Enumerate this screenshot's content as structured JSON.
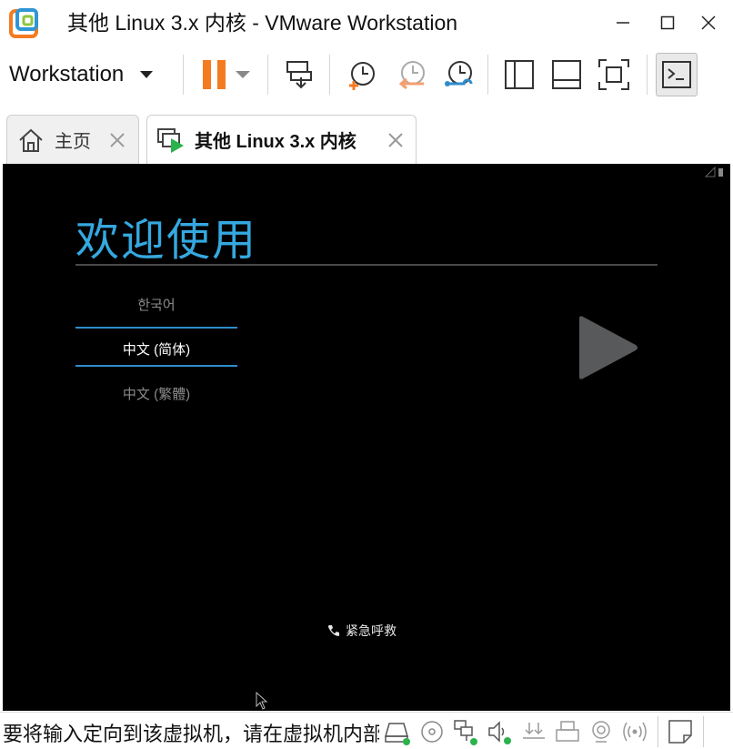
{
  "window": {
    "title": "其他 Linux 3.x 内核 - VMware Workstation",
    "controls": [
      "minimize",
      "maximize",
      "close"
    ]
  },
  "toolbar": {
    "menu_label": "Workstation",
    "buttons": [
      "pause-icon",
      "send-keys-icon",
      "snapshot-take-icon",
      "snapshot-revert-icon",
      "snapshot-manager-icon",
      "library-icon",
      "thumbnail-icon",
      "fullscreen-icon",
      "console-view-icon"
    ]
  },
  "tabs": [
    {
      "label": "主页",
      "icon": "home-icon"
    },
    {
      "label": "其他 Linux 3.x 内核",
      "icon": "vm-running-icon",
      "active": true
    }
  ],
  "vm": {
    "heading": "欢迎使用",
    "languages": [
      {
        "label": "한국어"
      },
      {
        "label": "中文 (简体)",
        "selected": true
      },
      {
        "label": "中文 (繁體)"
      }
    ],
    "emergency_label": "紧急呼救"
  },
  "statusbar": {
    "message": "要将输入定向到该虚拟机，请在虚拟机内部单击或按 Ctrl+G。",
    "devices": [
      "hard-disk-icon",
      "cd-dvd-icon",
      "network-adapter-icon",
      "sound-card-icon",
      "usb-icon",
      "printer-icon",
      "camera-icon",
      "wireless-icon",
      "message-log-icon"
    ]
  },
  "colors": {
    "accent_blue": "#35a8e0",
    "selection_line": "#2f8ccc",
    "pause_orange": "#f47b20",
    "vm_background": "#000000",
    "active_led_green": "#2bb24c"
  }
}
